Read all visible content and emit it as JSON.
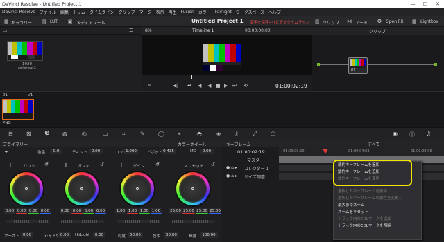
{
  "window": {
    "title": "DaVinci Resolve - Untitled Project 1",
    "minimize": "—",
    "maximize": "☐",
    "close": "✕"
  },
  "menu": [
    "DaVinci Resolve",
    "ファイル",
    "編集",
    "トリム",
    "タイムライン",
    "クリップ",
    "マーク",
    "表示",
    "再生",
    "Fusion",
    "カラー",
    "Fairlight",
    "ワークスペース",
    "ヘルプ"
  ],
  "toolbar": {
    "gallery": "ギャラリー",
    "lut": "LUT",
    "media_pool": "メディアプール",
    "project_title": "Untitled Project 1",
    "edited_notice": "変更を保存中 (ビデオタイムライン",
    "clips": "クリップ",
    "nodes": "ノード",
    "open_fx": "Open FX",
    "lightbox": "Lightbox"
  },
  "viewer": {
    "zoom": "8%",
    "timeline": "Timeline 1",
    "timecode_top": "00:00:00:00",
    "timecode": "01:00:02:19"
  },
  "node_panel": {
    "mode": "クリップ",
    "node_label": "01"
  },
  "media_pool": {
    "clip_name": "1920 colorbar1"
  },
  "clip_strip": {
    "index": "01",
    "track": "V1",
    "format": "PNG"
  },
  "color_panel": {
    "header": "プライマリー",
    "mode": "カラーホイール",
    "row1": {
      "contrast_lbl": "色温",
      "contrast_val": "0.0",
      "tint_lbl": "ティント",
      "tint_val": "0.00",
      "cont_lbl": "コン",
      "cont_val": "1.000",
      "pivot_lbl": "ピボット",
      "pivot_val": "0.435",
      "md_lbl": "MD",
      "md_val": "0.00"
    },
    "wheels": [
      {
        "name": "リフト",
        "values": [
          "0.00",
          "0.00",
          "0.00",
          "0.00"
        ]
      },
      {
        "name": "ガンマ",
        "values": [
          "0.00",
          "0.00",
          "0.00",
          "0.00"
        ]
      },
      {
        "name": "ゲイン",
        "values": [
          "1.00",
          "1.00",
          "1.00",
          "1.00"
        ]
      },
      {
        "name": "オフセット",
        "values": [
          "25.00",
          "25.00",
          "25.00",
          "25.00"
        ]
      }
    ],
    "bottom": {
      "boost_lbl": "ブースト",
      "boost_val": "0.00",
      "shadow_lbl": "シャドウ",
      "shadow_val": "0.00",
      "hilight_lbl": "Hi/Light",
      "hilight_val": "0.00",
      "sat_lbl": "彩度",
      "sat_val": "50.00",
      "hue_lbl": "色相",
      "hue_val": "50.00",
      "lum_lbl": "輝度",
      "lum_val": "100.00"
    }
  },
  "keyframes": {
    "header": "キーフレーム",
    "filter": "すべて",
    "timecode": "01:00:02:19",
    "ruler": [
      "01:00:00:00",
      "01:00:04:03",
      "01:00:08:06"
    ],
    "master": "マスター",
    "tracks": [
      "コレクター 1",
      "サイズ調整"
    ]
  },
  "context_menu": {
    "items": [
      {
        "label": "静的キーフレームを追加",
        "enabled": true
      },
      {
        "label": "動的キーフレームを追加",
        "enabled": true
      },
      {
        "label": "動的キーフレームを変更",
        "enabled": false
      },
      {
        "label": "",
        "enabled": false
      },
      {
        "label": "選択したキーフレームを削除",
        "enabled": false
      },
      {
        "label": "選択したキーフレームの属性を変更...",
        "enabled": false
      },
      {
        "label": "最大までズーム",
        "enabled": true
      },
      {
        "label": "ズームをリセット",
        "enabled": true
      },
      {
        "label": "トラック内のEDLマークを追加",
        "enabled": false
      },
      {
        "label": "トラック内のEDLマークを削除",
        "enabled": true
      }
    ],
    "highlight_color": "#f2e400"
  }
}
